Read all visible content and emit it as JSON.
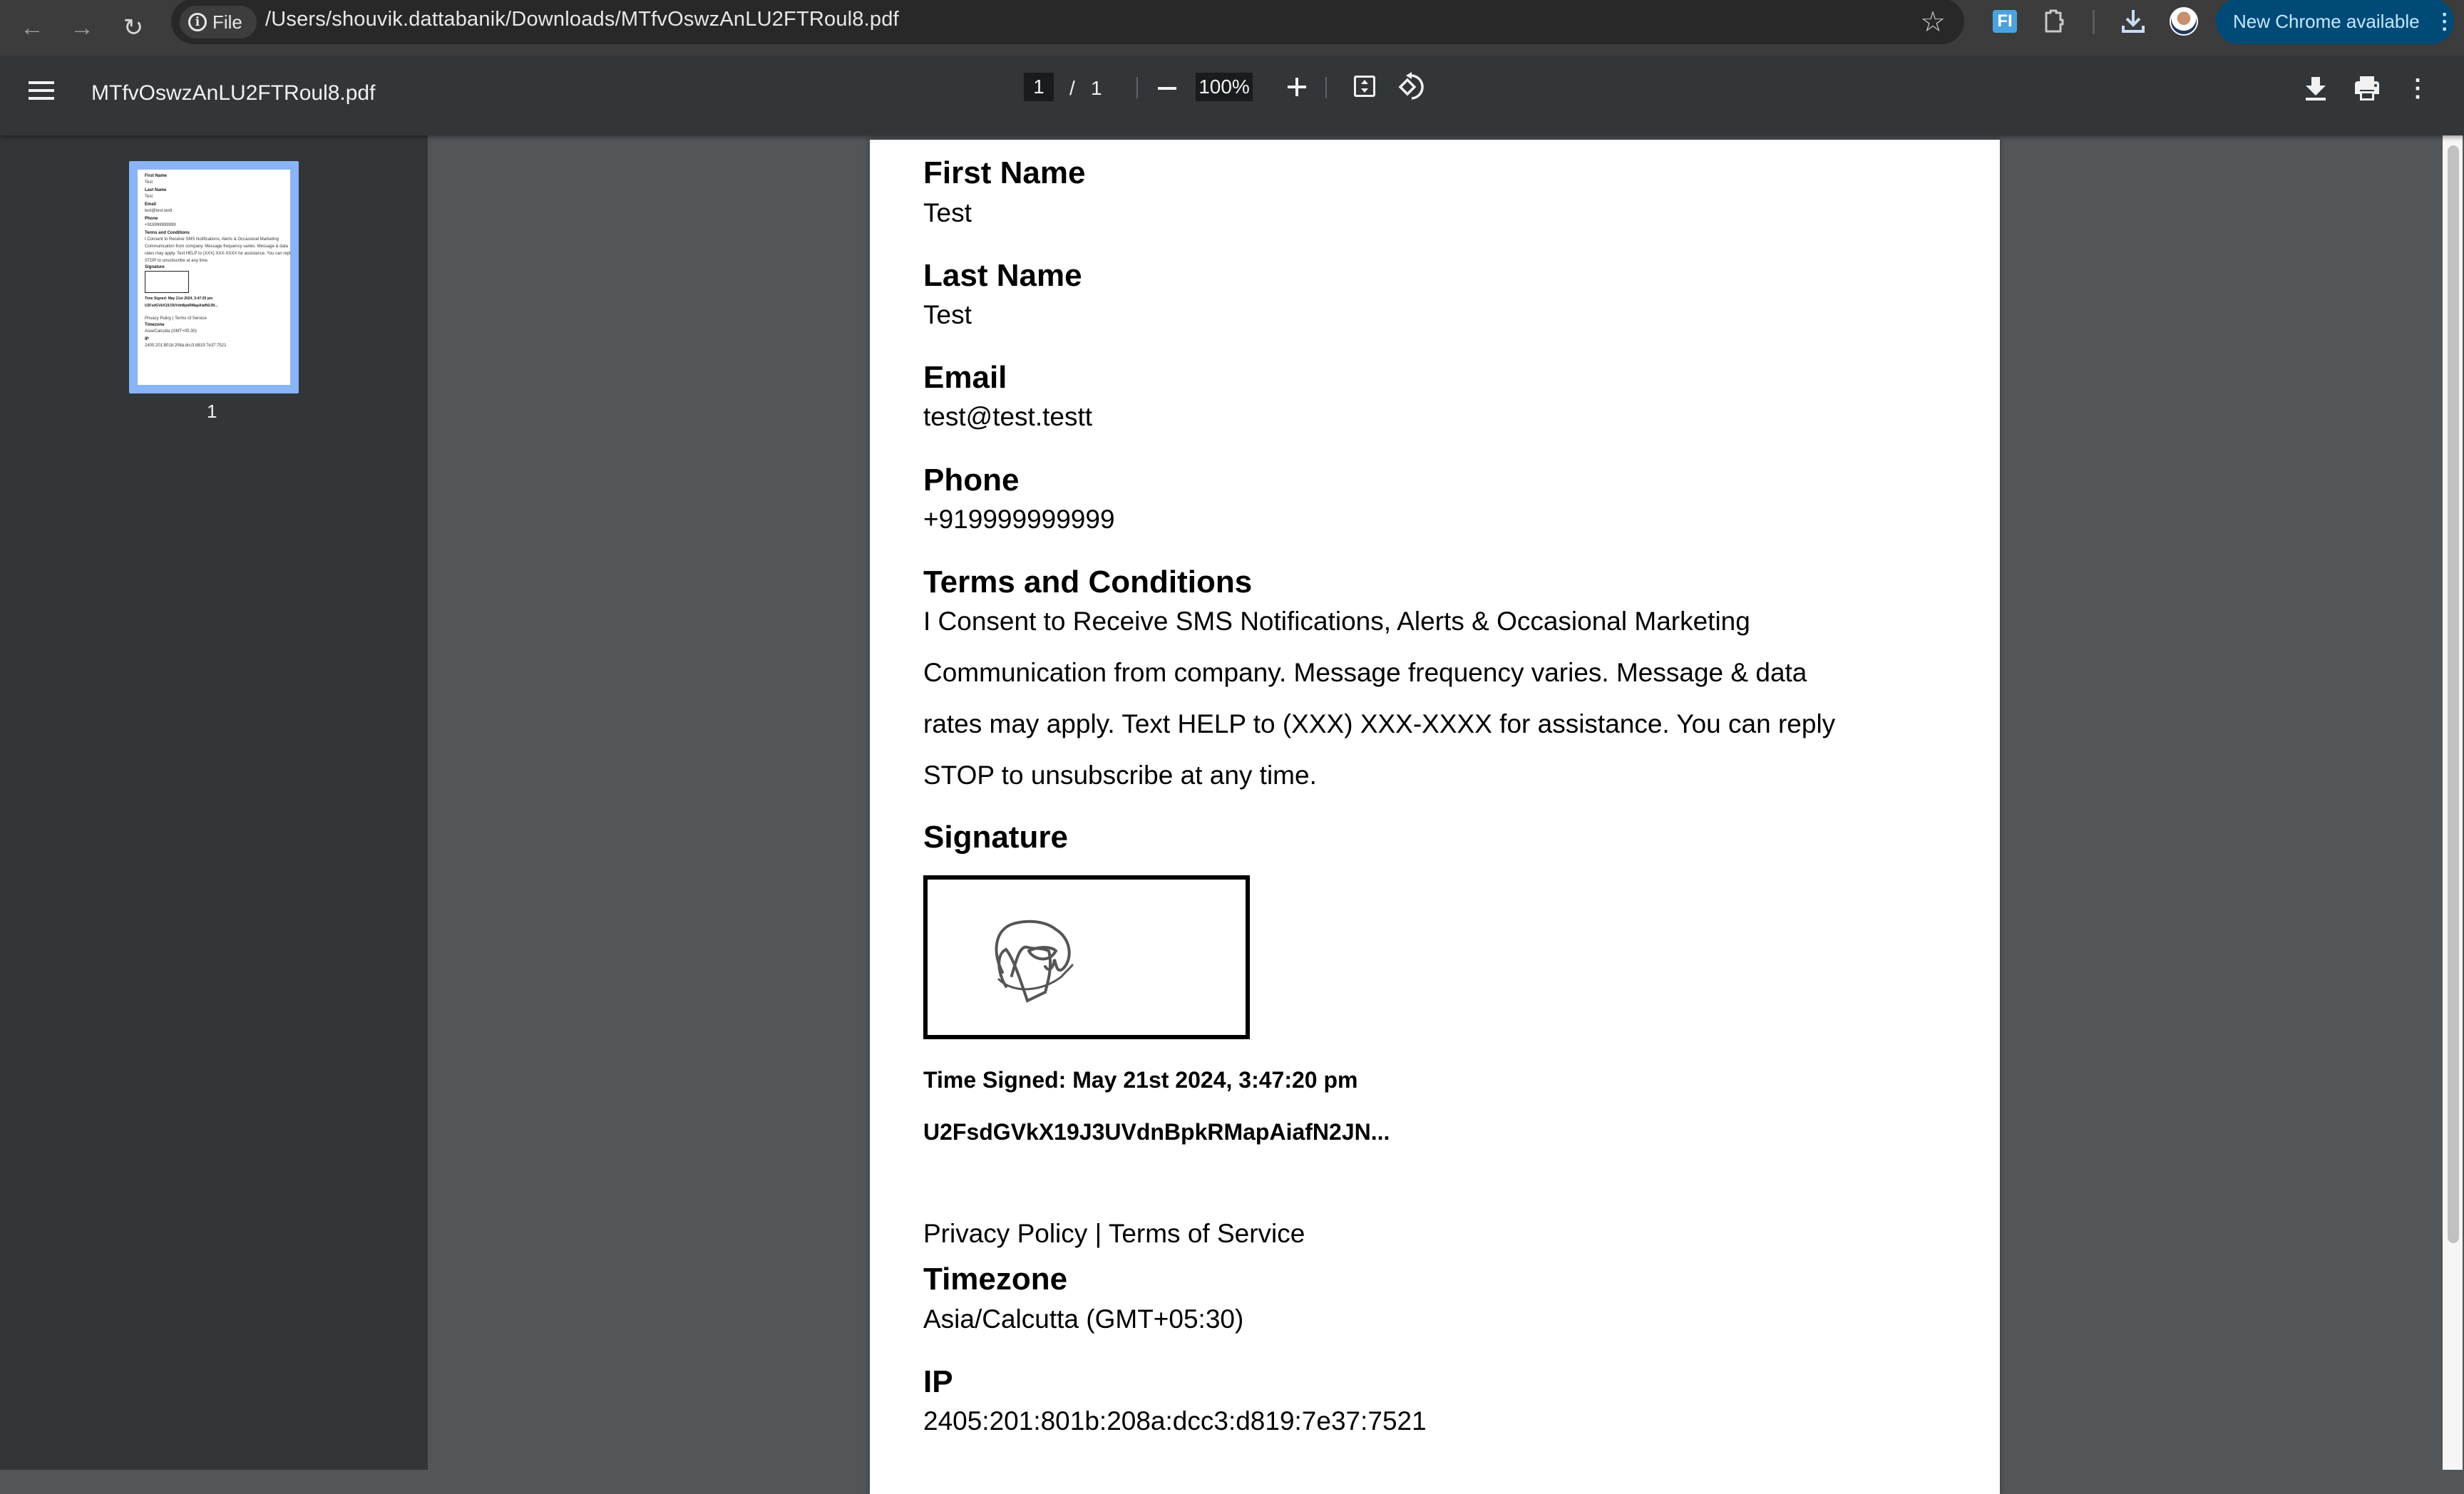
{
  "browser": {
    "url_chip_label": "File",
    "url": "/Users/shouvik.dattabanik/Downloads/MTfvOswzAnLU2FTRoul8.pdf",
    "extension_label": "FI",
    "update_button_label": "New Chrome available",
    "icons": {
      "back": "arrow-left",
      "forward": "arrow-right",
      "reload": "reload",
      "info": "info-circle",
      "bookmark": "star-outline",
      "extension": "fi-extension",
      "extensions": "puzzle",
      "downloads": "download",
      "profile": "avatar",
      "menu": "kebab-vertical"
    }
  },
  "pdf_toolbar": {
    "title": "MTfvOswzAnLU2FTRoul8.pdf",
    "current_page": "1",
    "page_separator": "/",
    "total_pages": "1",
    "zoom_level": "100%",
    "icons": {
      "menu": "hamburger",
      "zoom_out": "minus",
      "zoom_in": "plus",
      "fit": "fit-to-page",
      "rotate": "rotate-counterclockwise",
      "download": "download",
      "print": "printer",
      "more": "kebab-vertical"
    }
  },
  "sidebar": {
    "thumbnails": [
      {
        "page_number": "1",
        "selected": true
      }
    ],
    "accent_color": "#8ab4f8"
  },
  "document": {
    "fields": [
      {
        "label": "First Name",
        "value": "Test"
      },
      {
        "label": "Last Name",
        "value": "Test"
      },
      {
        "label": "Email",
        "value": "test@test.testt"
      },
      {
        "label": "Phone",
        "value": "+919999999999"
      }
    ],
    "terms": {
      "heading": "Terms and Conditions",
      "lines": [
        "I Consent to Receive SMS Notifications, Alerts & Occasional Marketing",
        "Communication from company. Message frequency varies. Message & data",
        "rates may apply. Text HELP to (XXX) XXX-XXXX for assistance. You can reply",
        "STOP to unsubscribe at any time."
      ]
    },
    "signature": {
      "heading": "Signature",
      "time_signed": "Time Signed: May 21st 2024, 3:47:20 pm",
      "hash": "U2FsdGVkX19J3UVdnBpkRMapAiafN2JN..."
    },
    "links": {
      "privacy": "Privacy Policy",
      "separator": "|",
      "terms": "Terms of Service"
    },
    "timezone": {
      "label": "Timezone",
      "value": "Asia/Calcutta (GMT+05:30)"
    },
    "ip": {
      "label": "IP",
      "value": "2405:201:801b:208a:dcc3:d819:7e37:7521"
    }
  },
  "colors": {
    "chrome_bar": "#3c3c3c",
    "omnibox": "#282828",
    "pdf_toolbar": "#323639",
    "viewer_background": "#525659",
    "update_pill": "#004a77",
    "update_pill_text": "#c4e7ff"
  }
}
